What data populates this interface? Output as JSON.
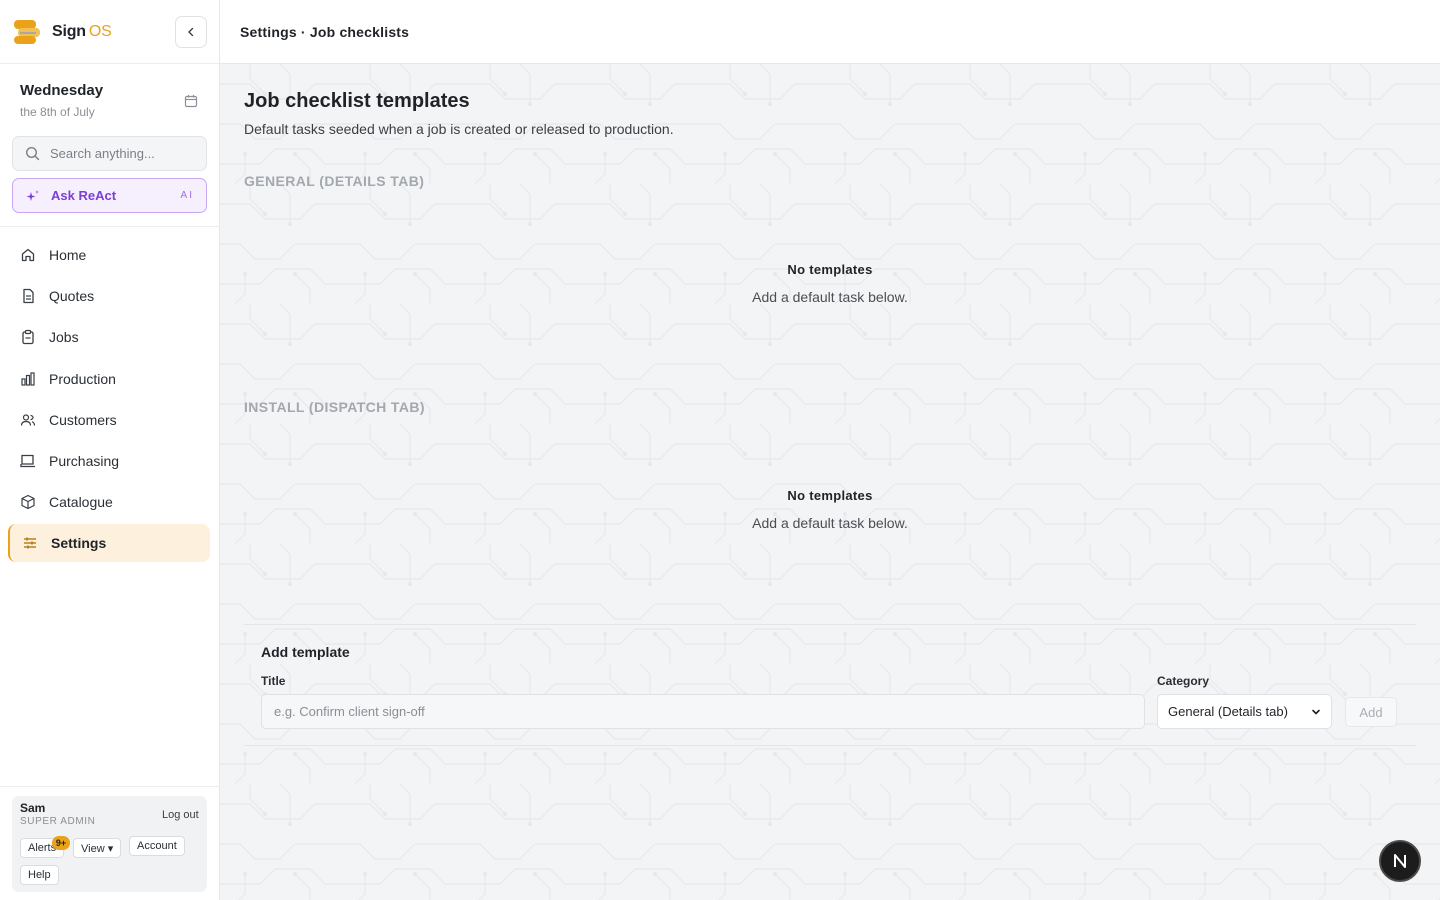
{
  "brand": {
    "name": "Sign",
    "suffix": "OS"
  },
  "sidebar": {
    "date": {
      "day": "Wednesday",
      "sub": "the 8th of July"
    },
    "search": {
      "placeholder": "Search anything..."
    },
    "ask": {
      "label": "Ask ReAct",
      "tag": "AI"
    },
    "items": [
      {
        "label": "Home",
        "icon": "home-icon"
      },
      {
        "label": "Quotes",
        "icon": "document-icon"
      },
      {
        "label": "Jobs",
        "icon": "clipboard-icon"
      },
      {
        "label": "Production",
        "icon": "bar-chart-icon"
      },
      {
        "label": "Customers",
        "icon": "users-icon"
      },
      {
        "label": "Purchasing",
        "icon": "purchase-icon"
      },
      {
        "label": "Catalogue",
        "icon": "box-icon"
      },
      {
        "label": "Settings",
        "icon": "sliders-icon",
        "active": true
      }
    ],
    "user": {
      "name": "Sam",
      "role": "SUPER ADMIN",
      "logout": "Log out",
      "alerts": "Alerts",
      "alerts_badge": "9+",
      "view": "View ▾",
      "account": "Account",
      "help": "Help"
    }
  },
  "header": {
    "breadcrumb": "Settings · Job checklists"
  },
  "main": {
    "title": "Job checklist templates",
    "subtitle": "Default tasks seeded when a job is created or released to production.",
    "sections": [
      {
        "title": "GENERAL (DETAILS TAB)",
        "empty_title": "No templates",
        "empty_sub": "Add a default task below."
      },
      {
        "title": "INSTALL (DISPATCH TAB)",
        "empty_title": "No templates",
        "empty_sub": "Add a default task below."
      }
    ],
    "add_form": {
      "heading": "Add template",
      "title_label": "Title",
      "title_placeholder": "e.g. Confirm client sign-off",
      "title_value": "",
      "category_label": "Category",
      "category_value": "General (Details tab)",
      "add_button": "Add"
    }
  },
  "fab": {
    "label": "N"
  },
  "colors": {
    "accent": "#e9a21a",
    "ai_purple": "#7b3fd6",
    "active_bg": "#fdf1de"
  }
}
